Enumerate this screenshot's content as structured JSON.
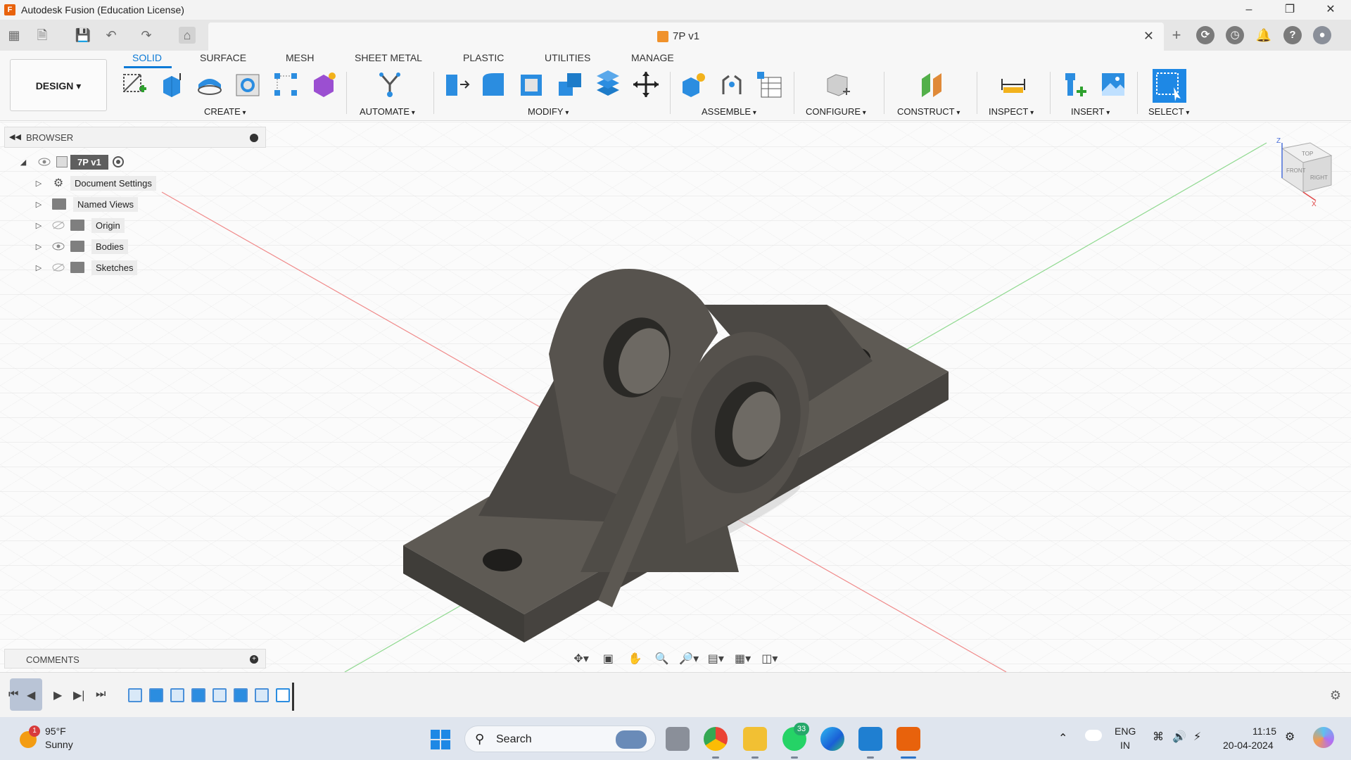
{
  "window": {
    "title": "Autodesk Fusion (Education License)",
    "logo_letter": "F"
  },
  "document": {
    "tab_label": "7P v1"
  },
  "ribbon": {
    "workspace": "DESIGN",
    "tabs": [
      "SOLID",
      "SURFACE",
      "MESH",
      "SHEET METAL",
      "PLASTIC",
      "UTILITIES",
      "MANAGE"
    ],
    "active_tab": "SOLID",
    "groups": {
      "create": "CREATE",
      "automate": "AUTOMATE",
      "modify": "MODIFY",
      "assemble": "ASSEMBLE",
      "configure": "CONFIGURE",
      "construct": "CONSTRUCT",
      "inspect": "INSPECT",
      "insert": "INSERT",
      "select": "SELECT"
    }
  },
  "browser": {
    "title": "BROWSER",
    "root": "7P v1",
    "items": [
      {
        "label": "Document Settings",
        "icon": "gear-icon"
      },
      {
        "label": "Named Views",
        "icon": "folder-icon"
      },
      {
        "label": "Origin",
        "icon": "folder-icon",
        "visibility": "hidden"
      },
      {
        "label": "Bodies",
        "icon": "folder-icon",
        "visibility": "visible"
      },
      {
        "label": "Sketches",
        "icon": "folder-icon",
        "visibility": "hidden"
      }
    ]
  },
  "comments": {
    "title": "COMMENTS"
  },
  "viewcube": {
    "top": "TOP",
    "front": "FRONT",
    "right": "RIGHT",
    "axis_z": "Z",
    "axis_x": "X"
  },
  "taskbar": {
    "weather_temp": "95°F",
    "weather_cond": "Sunny",
    "weather_badge": "1",
    "search_label": "Search",
    "whatsapp_badge": "33",
    "lang_top": "ENG",
    "lang_bottom": "IN",
    "time": "11:15",
    "date": "20-04-2024"
  },
  "colors": {
    "accent": "#0c7ad6",
    "part_fill": "#4d4a45",
    "select_blue": "#1e88e5",
    "fusion_orange": "#e8620c"
  }
}
